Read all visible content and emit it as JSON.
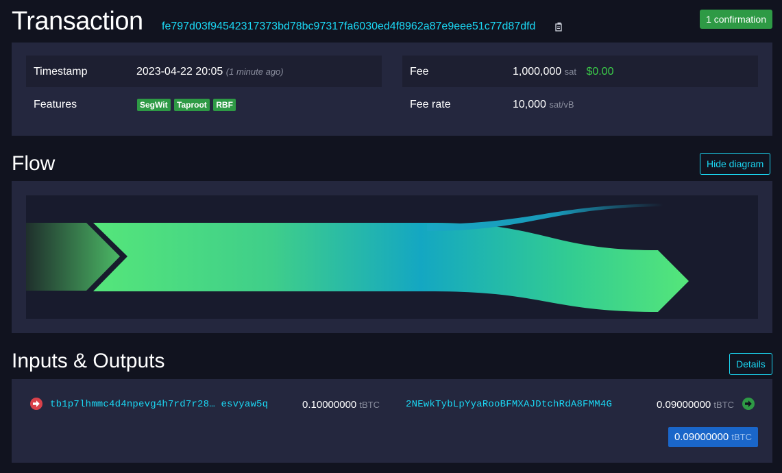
{
  "header": {
    "title": "Transaction",
    "txid": "fe797d03f94542317373bd78bc97317fa6030ed4f8962a87e9eee51c77d87dfd",
    "confirmation": "1 confirmation"
  },
  "details": {
    "timestamp_label": "Timestamp",
    "timestamp_value": "2023-04-22 20:05",
    "timestamp_relative": "(1 minute ago)",
    "features_label": "Features",
    "features": [
      "SegWit",
      "Taproot",
      "RBF"
    ],
    "fee_label": "Fee",
    "fee_value": "1,000,000",
    "fee_unit": "sat",
    "fee_fiat": "$0.00",
    "fee_rate_label": "Fee rate",
    "fee_rate_value": "10,000",
    "fee_rate_unit": "sat/vB"
  },
  "flow": {
    "title": "Flow",
    "hide_button": "Hide diagram"
  },
  "io": {
    "title": "Inputs & Outputs",
    "details_button": "Details",
    "input": {
      "address": "tb1p7lhmmc4d4npevg4h7rd7r28… esvyaw5q",
      "amount": "0.10000000",
      "unit": "tBTC"
    },
    "output": {
      "address": "2NEwkTybLpYyaRooBFMXAJDtchRdA8FMM4G",
      "amount": "0.09000000",
      "unit": "tBTC"
    },
    "total": {
      "amount": "0.09000000",
      "unit": "tBTC"
    }
  },
  "colors": {
    "accent": "#1bd8f4",
    "green": "#2e9a45",
    "red": "#d9414a",
    "blue": "#1a66c9"
  }
}
